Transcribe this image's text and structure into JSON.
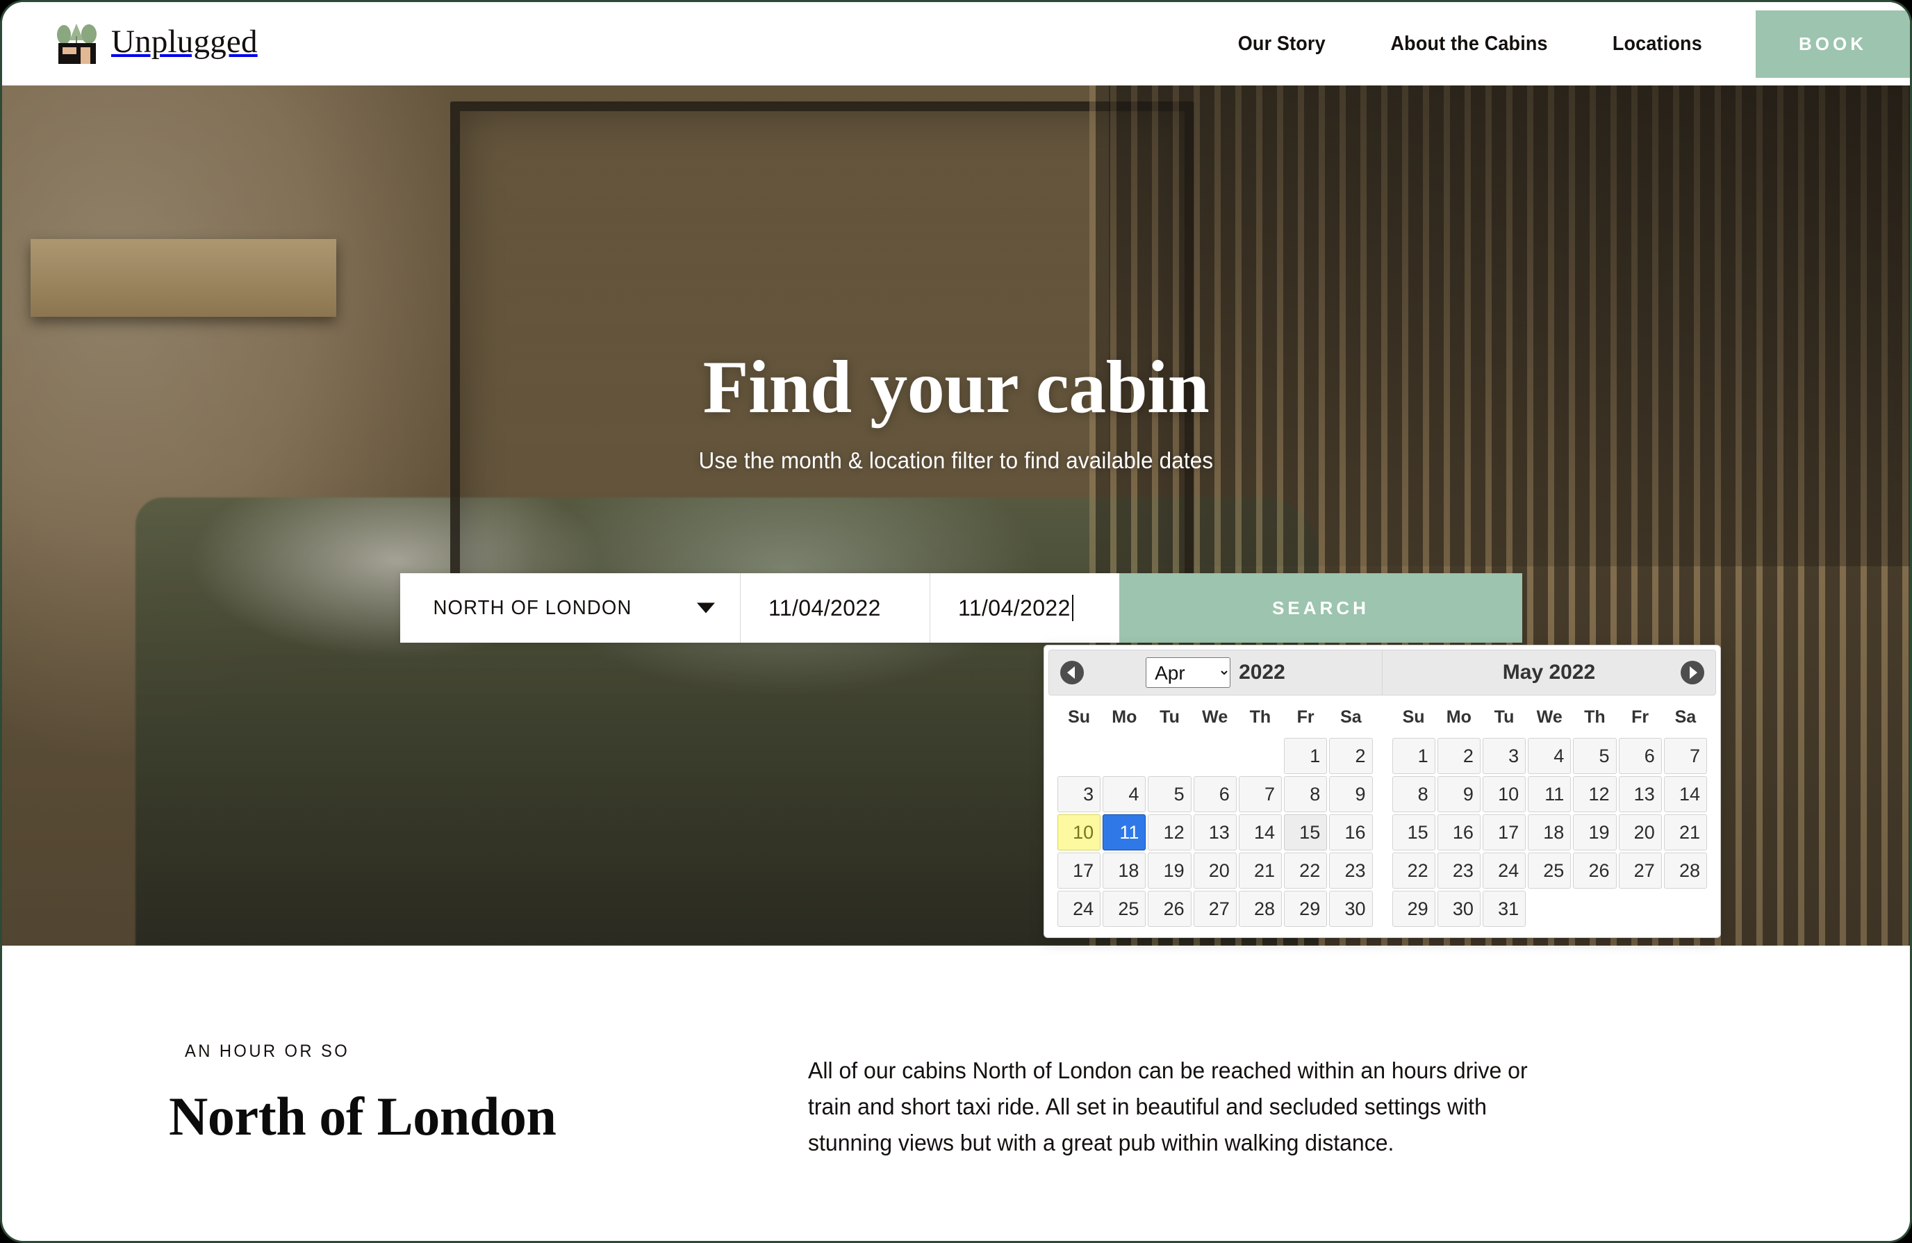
{
  "header": {
    "brand_name": "Unplugged",
    "nav_items": [
      {
        "label": "Our Story"
      },
      {
        "label": "About the Cabins"
      },
      {
        "label": "Locations"
      }
    ],
    "book_label": "BOOK"
  },
  "hero": {
    "title": "Find your cabin",
    "subtitle": "Use the month & location filter to find available dates"
  },
  "search": {
    "location_value": "NORTH OF LONDON",
    "date_from": "11/04/2022",
    "date_to": "11/04/2022",
    "search_label": "SEARCH"
  },
  "datepicker": {
    "prev_label": "Previous month",
    "next_label": "Next month",
    "month_select_value": "Apr",
    "left_year": "2022",
    "right_title": "May 2022",
    "weekdays": [
      "Su",
      "Mo",
      "Tu",
      "We",
      "Th",
      "Fr",
      "Sa"
    ],
    "left_month": {
      "name": "Apr",
      "year": "2022",
      "lead_blanks": 5,
      "days": [
        1,
        2,
        3,
        4,
        5,
        6,
        7,
        8,
        9,
        10,
        11,
        12,
        13,
        14,
        15,
        16,
        17,
        18,
        19,
        20,
        21,
        22,
        23,
        24,
        25,
        26,
        27,
        28,
        29,
        30
      ],
      "today": 10,
      "selected": 11,
      "hover": 15
    },
    "right_month": {
      "name": "May",
      "year": "2022",
      "lead_blanks": 0,
      "days": [
        1,
        2,
        3,
        4,
        5,
        6,
        7,
        8,
        9,
        10,
        11,
        12,
        13,
        14,
        15,
        16,
        17,
        18,
        19,
        20,
        21,
        22,
        23,
        24,
        25,
        26,
        27,
        28,
        29,
        30,
        31
      ],
      "today": null,
      "selected": null,
      "hover": null
    }
  },
  "content": {
    "eyebrow": "AN HOUR OR SO",
    "heading": "North of London",
    "paragraph": "All of our cabins North of London can be reached within an hours drive or train and short taxi ride. All set in beautiful and secluded settings with stunning views but with a great pub within walking distance."
  },
  "colors": {
    "accent_green": "#9cc4ae",
    "frame_green": "#2d4a36",
    "today_yellow": "#fdf9a0",
    "selected_blue": "#2f78e8",
    "text_dark": "#14100d"
  }
}
